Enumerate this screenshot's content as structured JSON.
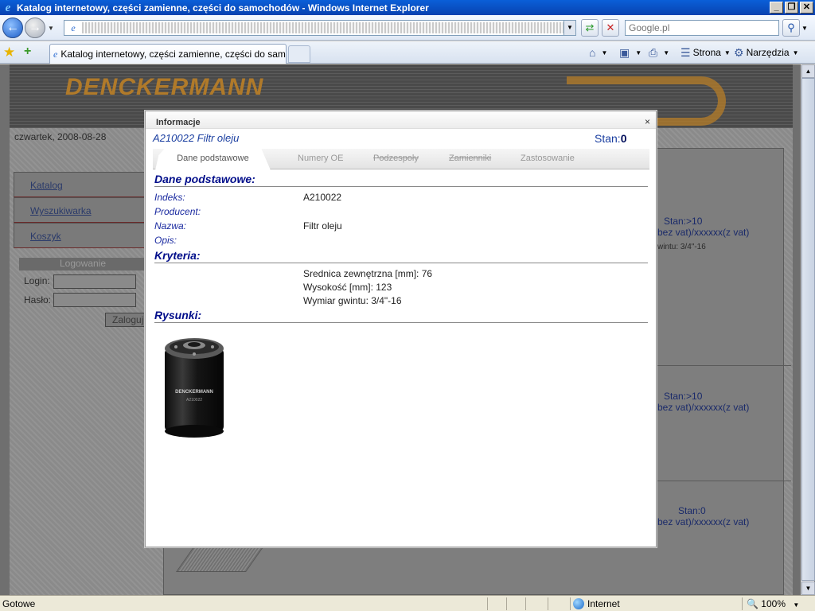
{
  "window": {
    "title": "Katalog internetowy, części zamienne, części do samochodów - Windows Internet Explorer",
    "minimize": "_",
    "maximize": "❐",
    "close": "✕"
  },
  "addressbar": {
    "search_placeholder": "Google.pl"
  },
  "tabs": {
    "active_title": "Katalog internetowy, części zamienne, części do samo..."
  },
  "commandbar": {
    "page_label": "Strona",
    "tools_label": "Narzędzia"
  },
  "site": {
    "logo": "DENCKERMANN",
    "date": "czwartek, 2008-08-28",
    "menu": [
      "Katalog",
      "Wyszukiwarka",
      "Koszyk"
    ],
    "login": {
      "heading": "Logowanie",
      "login_label": "Login:",
      "password_label": "Hasło:",
      "submit": "Zaloguj"
    },
    "products": [
      {
        "stan": "Stan:>10",
        "price": "bez vat)/xxxxxx(z vat)",
        "thread": "wintu: 3/4\"-16"
      },
      {
        "stan": "Stan:>10",
        "price": "bez vat)/xxxxxx(z vat)",
        "thread": ""
      },
      {
        "stan": "Stan:0",
        "price": "bez vat)/xxxxxx(z vat)",
        "thread": ""
      }
    ]
  },
  "modal": {
    "title": "Informacje",
    "close": "×",
    "product_title": "A210022 Filtr oleju",
    "stan_label": "Stan:",
    "stan_value": "0",
    "tabs": [
      "Dane podstawowe",
      "Numery OE",
      "Podzespoły",
      "Zamienniki",
      "Zastosowanie"
    ],
    "basic": {
      "heading": "Dane podstawowe:",
      "fields": [
        {
          "label": "Indeks:",
          "value": "A210022"
        },
        {
          "label": "Producent:",
          "value": ""
        },
        {
          "label": "Nazwa:",
          "value": "Filtr oleju"
        },
        {
          "label": "Opis:",
          "value": ""
        }
      ]
    },
    "criteria": {
      "heading": "Kryteria:",
      "items": [
        "Srednica zewnętrzna [mm]: 76",
        "Wysokość [mm]: 123",
        "Wymiar gwintu: 3/4\"-16"
      ]
    },
    "drawings": {
      "heading": "Rysunki:",
      "image_brand": "DENCKERMANN",
      "image_code": "A210022"
    }
  },
  "statusbar": {
    "status": "Gotowe",
    "zone": "Internet",
    "zoom": "100%"
  }
}
